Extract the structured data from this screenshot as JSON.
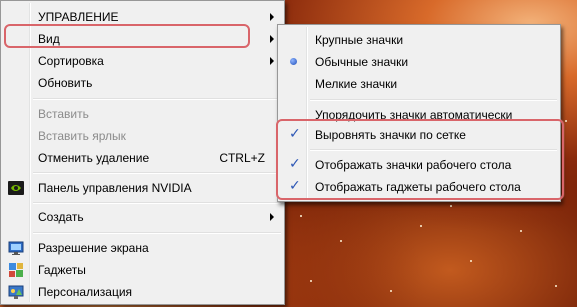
{
  "main_menu": {
    "items": [
      {
        "label": "УПРАВЛЕНИЕ"
      },
      {
        "label": "Вид"
      },
      {
        "label": "Сортировка"
      },
      {
        "label": "Обновить"
      },
      {
        "label": "Вставить"
      },
      {
        "label": "Вставить ярлык"
      },
      {
        "label": "Отменить удаление",
        "shortcut": "CTRL+Z"
      },
      {
        "label": "Панель управления NVIDIA"
      },
      {
        "label": "Создать"
      },
      {
        "label": "Разрешение экрана"
      },
      {
        "label": "Гаджеты"
      },
      {
        "label": "Персонализация"
      }
    ]
  },
  "sub_menu": {
    "items": [
      {
        "label": "Крупные значки"
      },
      {
        "label": "Обычные значки",
        "selected": true
      },
      {
        "label": "Мелкие значки"
      },
      {
        "label": "Упорядочить значки автоматически"
      },
      {
        "label": "Выровнять значки по сетке",
        "checked": true
      },
      {
        "label": "Отображать значки рабочего стола",
        "checked": true
      },
      {
        "label": "Отображать гаджеты  рабочего стола",
        "checked": true
      }
    ]
  },
  "colors": {
    "menu_background": "#f0f0f0",
    "highlight_outline": "#d9656a",
    "check_color": "#2c56b5",
    "disabled_text": "#8b8b8b"
  },
  "icons": [
    "nvidia-icon",
    "screen-resolution-icon",
    "gadgets-icon",
    "personalization-icon",
    "checkmark-icon",
    "radio-bullet-icon",
    "submenu-arrow-icon"
  ]
}
